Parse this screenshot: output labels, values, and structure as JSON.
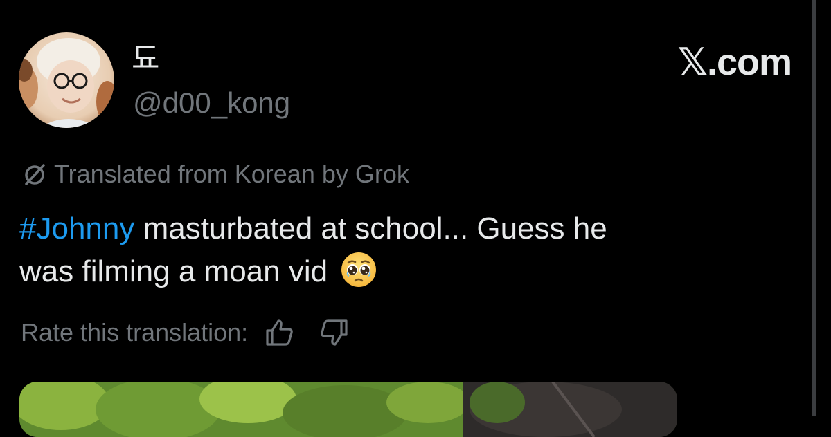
{
  "author": {
    "display_name": "됴",
    "handle": "@d00_kong"
  },
  "site": {
    "logo_text": "𝕏.com"
  },
  "translation": {
    "notice": "Translated from Korean by Grok",
    "icon": "translate-slash-icon"
  },
  "post": {
    "hashtag": "#Johnny",
    "text_line1": " masturbated at school... Guess he",
    "text_line2": "was filming a moan vid",
    "emoji": "pleading-face-emoji"
  },
  "rating": {
    "label": "Rate this translation:",
    "up_icon": "thumbs-up-icon",
    "down_icon": "thumbs-down-icon"
  },
  "colors": {
    "background": "#000000",
    "text_primary": "#e7e9ea",
    "text_secondary": "#71767b",
    "link": "#1d9bf0"
  }
}
